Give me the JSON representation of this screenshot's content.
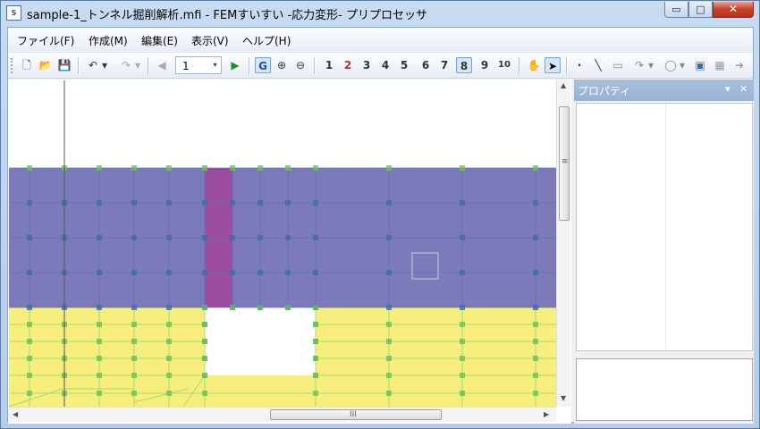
{
  "window": {
    "title": "sample-1_トンネル掘削解析.mfi - FEMすいすい -応力変形- プリプロセッサ",
    "app_icon_text": "S"
  },
  "window_controls": {
    "minimize": "▭",
    "maximize": "□",
    "close": "✕"
  },
  "menubar": {
    "items": [
      "ファイル(F)",
      "作成(M)",
      "編集(E)",
      "表示(V)",
      "ヘルプ(H)"
    ]
  },
  "toolbar": {
    "page_value": "1",
    "glyphs": {
      "new": "🗋",
      "open": "📂",
      "save": "💾",
      "undo": "↶",
      "undo_drop": "▾",
      "redo": "↷",
      "redo_drop": "▾",
      "prev": "◀",
      "combo_arrow": "▾",
      "next": "▶",
      "g": "G",
      "zoom_in": "⊕",
      "zoom_out": "⊖",
      "s1": "1",
      "s2": "2",
      "s3": "3",
      "s4": "4",
      "s5": "5",
      "s6": "6",
      "s7": "7",
      "s8": "8",
      "s9": "9",
      "s10": "10",
      "hand": "✋",
      "pointer": "➤",
      "point": "·",
      "line": "╲",
      "rect": "▭",
      "arc": "↷",
      "arc_drop": "▾",
      "circle": "◯",
      "circle_drop": "▾",
      "t1": "▣",
      "t2": "▦",
      "go": "➜"
    }
  },
  "canvas": {
    "colors": {
      "upper_layer": "#7d7abc",
      "lower_layer": "#f6ef7d",
      "excavation": "#9b4ea0",
      "opening": "#ffffff",
      "node": "#6bbf5a",
      "node_dark": "#3a6ea8"
    },
    "scroll": {
      "v_grip": "≡",
      "h_grip": "III",
      "up": "▲",
      "down": "▼",
      "left": "◀",
      "right": "▶"
    }
  },
  "properties_panel": {
    "title": "プロパティ",
    "dropdown": "▾",
    "close": "✕"
  }
}
